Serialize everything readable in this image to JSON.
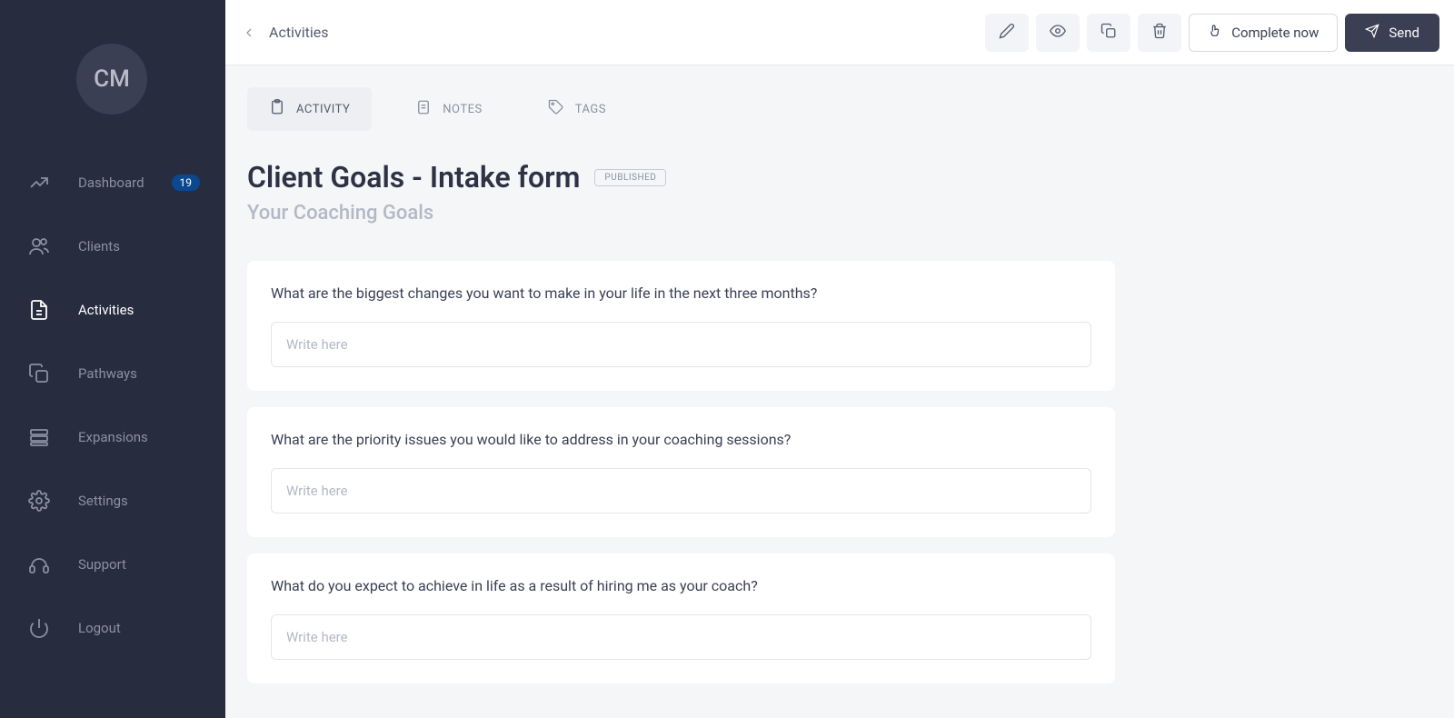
{
  "avatar": {
    "initials": "CM"
  },
  "sidebar": {
    "items": [
      {
        "label": "Dashboard",
        "badge": "19"
      },
      {
        "label": "Clients"
      },
      {
        "label": "Activities"
      },
      {
        "label": "Pathways"
      },
      {
        "label": "Expansions"
      },
      {
        "label": "Settings"
      },
      {
        "label": "Support"
      },
      {
        "label": "Logout"
      }
    ]
  },
  "header": {
    "breadcrumb": "Activities",
    "complete_label": "Complete now",
    "send_label": "Send"
  },
  "tabs": {
    "activity": "ACTIVITY",
    "notes": "NOTES",
    "tags": "TAGS"
  },
  "page": {
    "title": "Client Goals - Intake form",
    "status": "PUBLISHED",
    "subtitle": "Your Coaching Goals"
  },
  "questions": [
    {
      "label": "What are the biggest changes you want to make in your life in the next three months?",
      "placeholder": "Write here"
    },
    {
      "label": "What are the priority issues you would like to address in your coaching sessions?",
      "placeholder": "Write here"
    },
    {
      "label": "What do you expect to achieve in life as a result of hiring me as your coach?",
      "placeholder": "Write here"
    }
  ]
}
